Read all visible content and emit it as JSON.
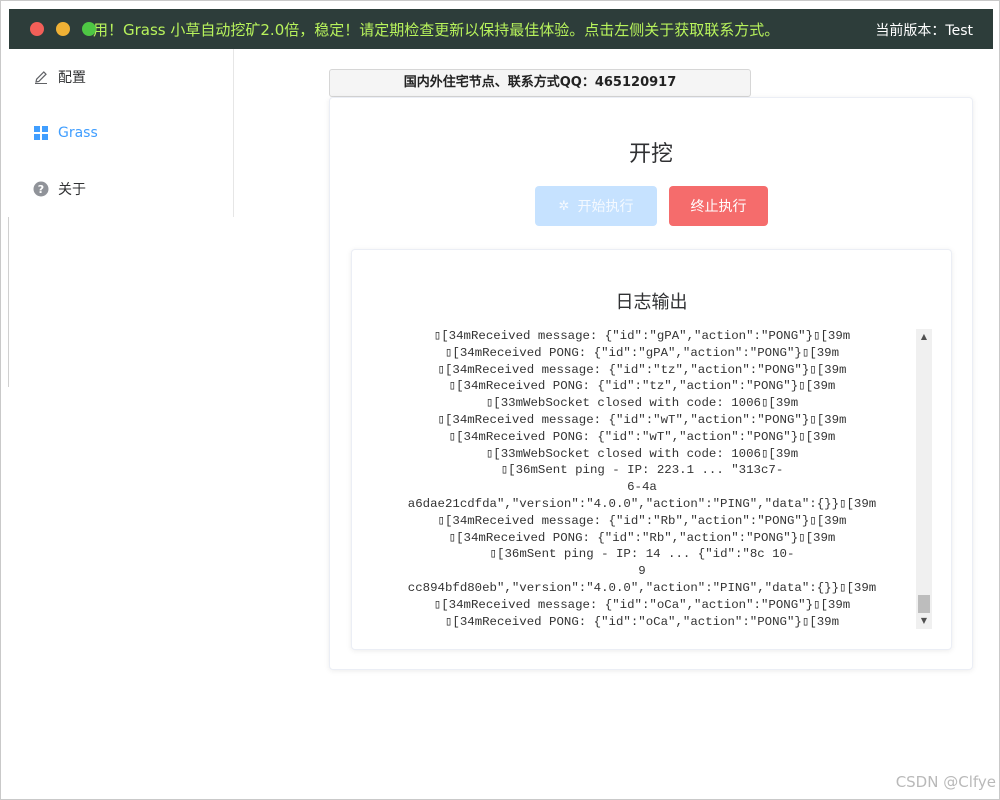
{
  "titlebar": {
    "marquee": "用！Grass 小草自动挖矿2.0倍，稳定！请定期检查更新以保持最佳体验。点击左侧关于获取联系方式。",
    "version": "当前版本：Test"
  },
  "sidebar": {
    "items": [
      {
        "label": "配置",
        "icon": "edit-icon"
      },
      {
        "label": "Grass",
        "icon": "grid-icon",
        "active": true
      },
      {
        "label": "关于",
        "icon": "question-icon"
      }
    ]
  },
  "banner": "国内外住宅节点、联系方式QQ：465120917",
  "main": {
    "title": "开挖",
    "start_button": "开始执行",
    "stop_button": "终止执行"
  },
  "log": {
    "title": "日志输出",
    "lines": [
      "▯[34mReceived message: {\"id\":\"gPA\",\"action\":\"PONG\"}▯[39m",
      "▯[34mReceived PONG: {\"id\":\"gPA\",\"action\":\"PONG\"}▯[39m",
      "▯[34mReceived message: {\"id\":\"tz\",\"action\":\"PONG\"}▯[39m",
      "▯[34mReceived PONG: {\"id\":\"tz\",\"action\":\"PONG\"}▯[39m",
      "▯[33mWebSocket closed with code: 1006▯[39m",
      "▯[34mReceived message: {\"id\":\"wT\",\"action\":\"PONG\"}▯[39m",
      "▯[34mReceived PONG: {\"id\":\"wT\",\"action\":\"PONG\"}▯[39m",
      "▯[33mWebSocket closed with code: 1006▯[39m",
      "▯[36mSent ping - IP: 223.1 ... \"313c7-",
      "6-4a",
      "a6dae21cdfda\",\"version\":\"4.0.0\",\"action\":\"PING\",\"data\":{}}▯[39m",
      "▯[34mReceived message: {\"id\":\"Rb\",\"action\":\"PONG\"}▯[39m",
      "▯[34mReceived PONG: {\"id\":\"Rb\",\"action\":\"PONG\"}▯[39m",
      "▯[36mSent ping - IP: 14 ... {\"id\":\"8c 10-",
      "9",
      "cc894bfd80eb\",\"version\":\"4.0.0\",\"action\":\"PING\",\"data\":{}}▯[39m",
      "▯[34mReceived message: {\"id\":\"oCa\",\"action\":\"PONG\"}▯[39m",
      "▯[34mReceived PONG: {\"id\":\"oCa\",\"action\":\"PONG\"}▯[39m"
    ]
  },
  "watermark": "CSDN @Clfye"
}
